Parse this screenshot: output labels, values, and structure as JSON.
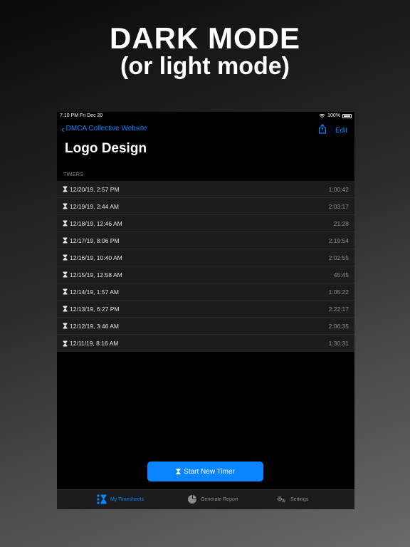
{
  "promo": {
    "line1": "DARK MODE",
    "line2": "(or light mode)"
  },
  "statusbar": {
    "time_date": "7:10 PM   Fri Dec 20",
    "battery": "100%"
  },
  "nav": {
    "back_label": "DMCA Collective Website",
    "edit_label": "Edit"
  },
  "page_title": "Logo Design",
  "section_header": "TIMERS",
  "timers": [
    {
      "date": "12/20/19, 2:57 PM",
      "duration": "1:00:42"
    },
    {
      "date": "12/19/19, 2:44 AM",
      "duration": "2:03:17"
    },
    {
      "date": "12/18/19, 12:46 AM",
      "duration": "21:28"
    },
    {
      "date": "12/17/19, 8:06 PM",
      "duration": "2:19:54"
    },
    {
      "date": "12/16/19, 10:40 AM",
      "duration": "2:02:55"
    },
    {
      "date": "12/15/19, 12:58 AM",
      "duration": "45:45"
    },
    {
      "date": "12/14/19, 1:57 AM",
      "duration": "1:05:22"
    },
    {
      "date": "12/13/19, 6:27 PM",
      "duration": "2:22:17"
    },
    {
      "date": "12/12/19, 3:46 AM",
      "duration": "2:06:35"
    },
    {
      "date": "12/11/19, 8:16 AM",
      "duration": "1:30:31"
    }
  ],
  "start_button_label": "Start New Timer",
  "tabs": [
    {
      "label": "My Timesheets",
      "icon": "timesheets-icon",
      "active": true
    },
    {
      "label": "Generate Report",
      "icon": "pie-chart-icon",
      "active": false
    },
    {
      "label": "Settings",
      "icon": "gears-icon",
      "active": false
    }
  ],
  "colors": {
    "accent": "#0a84ff",
    "background": "#000000",
    "list_background": "#1c1c1e",
    "secondary_text": "#8e8e93"
  }
}
